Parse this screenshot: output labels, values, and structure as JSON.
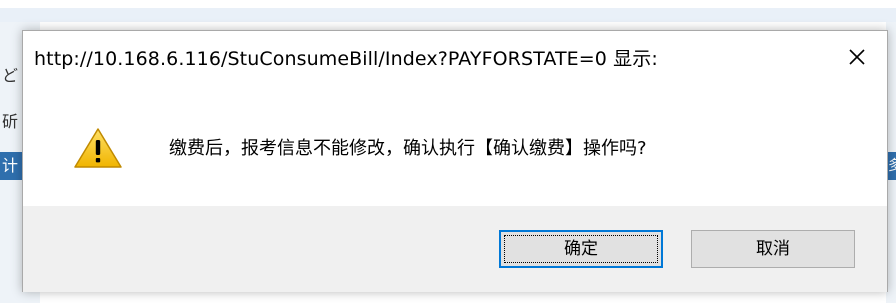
{
  "background": {
    "fragment_a": "ど",
    "fragment_b": "斫",
    "fragment_c": "计",
    "fragment_d": "多"
  },
  "dialog": {
    "title": "http://10.168.6.116/StuConsumeBill/Index?PAYFORSTATE=0 显示:",
    "close_icon": "close-icon",
    "warning_icon": "warning-icon",
    "message": "缴费后，报考信息不能修改，确认执行【确认缴费】操作吗?",
    "ok_label": "确定",
    "cancel_label": "取消"
  },
  "colors": {
    "focus_border": "#0078d7",
    "footer_bg": "#f0f0f0",
    "button_bg": "#e1e1e1",
    "warning_yellow": "#f3c51b"
  }
}
